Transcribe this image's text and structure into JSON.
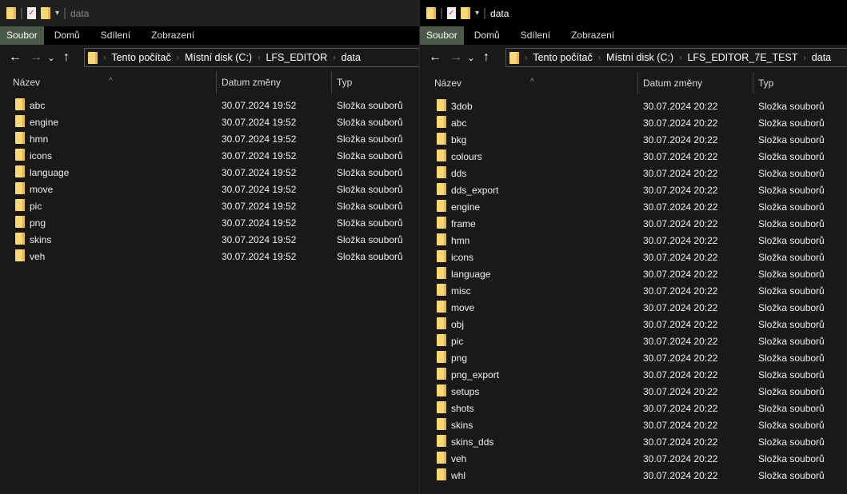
{
  "left": {
    "title": "data",
    "ribbon": [
      "Soubor",
      "Domů",
      "Sdílení",
      "Zobrazení"
    ],
    "path": [
      "Tento počítač",
      "Místní disk (C:)",
      "LFS_EDITOR",
      "data"
    ],
    "columns": [
      "Název",
      "Datum změny",
      "Typ"
    ],
    "items": [
      {
        "name": "abc",
        "date": "30.07.2024 19:52",
        "type": "Složka souborů"
      },
      {
        "name": "engine",
        "date": "30.07.2024 19:52",
        "type": "Složka souborů"
      },
      {
        "name": "hmn",
        "date": "30.07.2024 19:52",
        "type": "Složka souborů"
      },
      {
        "name": "icons",
        "date": "30.07.2024 19:52",
        "type": "Složka souborů"
      },
      {
        "name": "language",
        "date": "30.07.2024 19:52",
        "type": "Složka souborů"
      },
      {
        "name": "move",
        "date": "30.07.2024 19:52",
        "type": "Složka souborů"
      },
      {
        "name": "pic",
        "date": "30.07.2024 19:52",
        "type": "Složka souborů"
      },
      {
        "name": "png",
        "date": "30.07.2024 19:52",
        "type": "Složka souborů"
      },
      {
        "name": "skins",
        "date": "30.07.2024 19:52",
        "type": "Složka souborů"
      },
      {
        "name": "veh",
        "date": "30.07.2024 19:52",
        "type": "Složka souborů"
      }
    ]
  },
  "right": {
    "title": "data",
    "ribbon": [
      "Soubor",
      "Domů",
      "Sdílení",
      "Zobrazení"
    ],
    "path": [
      "Tento počítač",
      "Místní disk (C:)",
      "LFS_EDITOR_7E_TEST",
      "data"
    ],
    "columns": [
      "Název",
      "Datum změny",
      "Typ"
    ],
    "items": [
      {
        "name": "3dob",
        "date": "30.07.2024 20:22",
        "type": "Složka souborů"
      },
      {
        "name": "abc",
        "date": "30.07.2024 20:22",
        "type": "Složka souborů"
      },
      {
        "name": "bkg",
        "date": "30.07.2024 20:22",
        "type": "Složka souborů"
      },
      {
        "name": "colours",
        "date": "30.07.2024 20:22",
        "type": "Složka souborů"
      },
      {
        "name": "dds",
        "date": "30.07.2024 20:22",
        "type": "Složka souborů"
      },
      {
        "name": "dds_export",
        "date": "30.07.2024 20:22",
        "type": "Složka souborů"
      },
      {
        "name": "engine",
        "date": "30.07.2024 20:22",
        "type": "Složka souborů"
      },
      {
        "name": "frame",
        "date": "30.07.2024 20:22",
        "type": "Složka souborů"
      },
      {
        "name": "hmn",
        "date": "30.07.2024 20:22",
        "type": "Složka souborů"
      },
      {
        "name": "icons",
        "date": "30.07.2024 20:22",
        "type": "Složka souborů"
      },
      {
        "name": "language",
        "date": "30.07.2024 20:22",
        "type": "Složka souborů"
      },
      {
        "name": "misc",
        "date": "30.07.2024 20:22",
        "type": "Složka souborů"
      },
      {
        "name": "move",
        "date": "30.07.2024 20:22",
        "type": "Složka souborů"
      },
      {
        "name": "obj",
        "date": "30.07.2024 20:22",
        "type": "Složka souborů"
      },
      {
        "name": "pic",
        "date": "30.07.2024 20:22",
        "type": "Složka souborů"
      },
      {
        "name": "png",
        "date": "30.07.2024 20:22",
        "type": "Složka souborů"
      },
      {
        "name": "png_export",
        "date": "30.07.2024 20:22",
        "type": "Složka souborů"
      },
      {
        "name": "setups",
        "date": "30.07.2024 20:22",
        "type": "Složka souborů"
      },
      {
        "name": "shots",
        "date": "30.07.2024 20:22",
        "type": "Složka souborů"
      },
      {
        "name": "skins",
        "date": "30.07.2024 20:22",
        "type": "Složka souborů"
      },
      {
        "name": "skins_dds",
        "date": "30.07.2024 20:22",
        "type": "Složka souborů"
      },
      {
        "name": "veh",
        "date": "30.07.2024 20:22",
        "type": "Složka souborů"
      },
      {
        "name": "whl",
        "date": "30.07.2024 20:22",
        "type": "Složka souborů"
      }
    ]
  },
  "icons": {
    "back": "←",
    "forward": "→",
    "recent": "⌄",
    "up": "↑",
    "chevron": "›",
    "sort": "^",
    "dropdown": "▾",
    "properties": "✓"
  }
}
